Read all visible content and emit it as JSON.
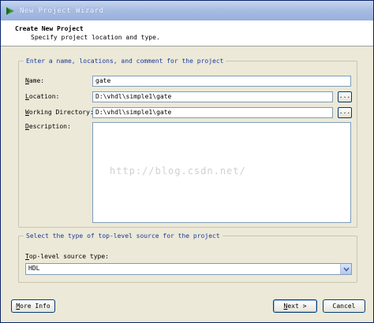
{
  "window": {
    "title": "New Project Wizard"
  },
  "header": {
    "title": "Create New Project",
    "subtitle": "Specify project location and type."
  },
  "group1": {
    "legend": "Enter a name, locations, and comment for the project",
    "name": {
      "label_key": "N",
      "label_rest": "ame:",
      "value": "gate"
    },
    "location": {
      "label_key": "L",
      "label_rest": "ocation:",
      "value": "D:\\vhdl\\simple1\\gate",
      "browse": "..."
    },
    "working_directory": {
      "label_key": "W",
      "label_rest": "orking Directory:",
      "value": "D:\\vhdl\\simple1\\gate",
      "browse": "..."
    },
    "description": {
      "label_key": "D",
      "label_rest": "escription:",
      "value": ""
    }
  },
  "watermark": "http://blog.csdn.net/",
  "group2": {
    "legend": "Select the type of top-level source for the project",
    "source_type": {
      "label_key": "T",
      "label_rest": "op-level source type:",
      "selected": "HDL"
    }
  },
  "buttons": {
    "more_info": {
      "key": "M",
      "rest": "ore Info"
    },
    "next": {
      "key": "N",
      "rest": "ext >"
    },
    "cancel": "Cancel"
  },
  "icons": {
    "title": "xilinx-logo-icon",
    "browse": "ellipsis-icon",
    "dropdown": "chevron-down-icon"
  }
}
